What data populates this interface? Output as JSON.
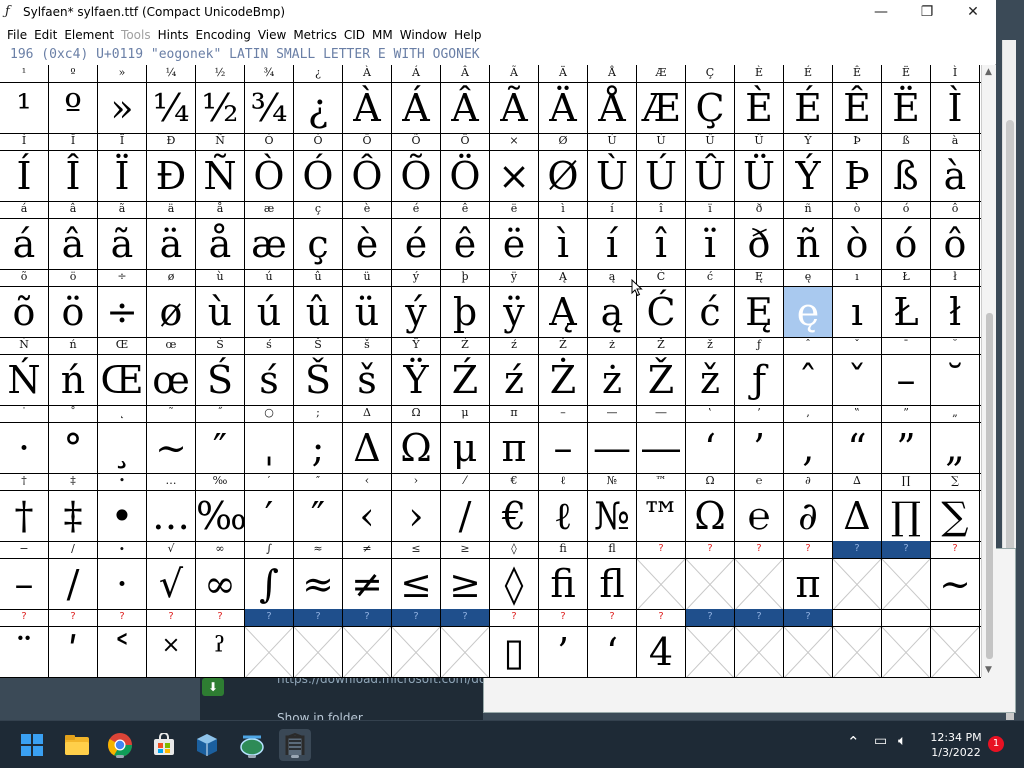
{
  "window": {
    "app_icon": "fontforge-f-icon",
    "title": "Sylfaen*  sylfaen.ttf (Compact UnicodeBmp)",
    "minimize": "—",
    "maximize": "❐",
    "close": "✕"
  },
  "menu": [
    "File",
    "Edit",
    "Element",
    "Tools",
    "Hints",
    "Encoding",
    "View",
    "Metrics",
    "CID",
    "MM",
    "Window",
    "Help"
  ],
  "menu_disabled": [
    "Tools"
  ],
  "info_line": "196 (0xc4) U+0119 \"eogonek\" LATIN SMALL LETTER E WITH OGONEK",
  "grid": {
    "rows": [
      {
        "labels": [
          "¹",
          "º",
          "»",
          "¼",
          "½",
          "¾",
          "¿",
          "À",
          "Á",
          "Â",
          "Ã",
          "Ä",
          "Å",
          "Æ",
          "Ç",
          "È",
          "É",
          "Ê",
          "Ë",
          "Ì"
        ],
        "glyphs": [
          "¹",
          "º",
          "»",
          "¼",
          "½",
          "¾",
          "¿",
          "À",
          "Á",
          "Â",
          "Ã",
          "Ä",
          "Å",
          "Æ",
          "Ç",
          "È",
          "É",
          "Ê",
          "Ë",
          "Ì"
        ]
      },
      {
        "labels": [
          "Í",
          "Î",
          "Ï",
          "Ð",
          "Ñ",
          "Ò",
          "Ó",
          "Ô",
          "Õ",
          "Ö",
          "×",
          "Ø",
          "Ù",
          "Ú",
          "Û",
          "Ü",
          "Ý",
          "Þ",
          "ß",
          "à"
        ],
        "glyphs": [
          "Í",
          "Î",
          "Ï",
          "Ð",
          "Ñ",
          "Ò",
          "Ó",
          "Ô",
          "Õ",
          "Ö",
          "×",
          "Ø",
          "Ù",
          "Ú",
          "Û",
          "Ü",
          "Ý",
          "Þ",
          "ß",
          "à"
        ]
      },
      {
        "labels": [
          "á",
          "â",
          "ã",
          "ä",
          "å",
          "æ",
          "ç",
          "è",
          "é",
          "ê",
          "ë",
          "ì",
          "í",
          "î",
          "ï",
          "ð",
          "ñ",
          "ò",
          "ó",
          "ô"
        ],
        "glyphs": [
          "á",
          "â",
          "ã",
          "ä",
          "å",
          "æ",
          "ç",
          "è",
          "é",
          "ê",
          "ë",
          "ì",
          "í",
          "î",
          "ï",
          "ð",
          "ñ",
          "ò",
          "ó",
          "ô"
        ]
      },
      {
        "labels": [
          "õ",
          "ö",
          "÷",
          "ø",
          "ù",
          "ú",
          "û",
          "ü",
          "ý",
          "þ",
          "ÿ",
          "Ą",
          "ą",
          "Ć",
          "ć",
          "Ę",
          "ę",
          "ı",
          "Ł",
          "ł"
        ],
        "glyphs": [
          "õ",
          "ö",
          "÷",
          "ø",
          "ù",
          "ú",
          "û",
          "ü",
          "ý",
          "þ",
          "ÿ",
          "Ą",
          "ą",
          "Ć",
          "ć",
          "Ę",
          "ę",
          "ı",
          "Ł",
          "ł"
        ]
      },
      {
        "labels": [
          "Ń",
          "ń",
          "Œ",
          "œ",
          "Ś",
          "ś",
          "Š",
          "š",
          "Ÿ",
          "Ź",
          "ź",
          "Ż",
          "ż",
          "Ž",
          "ž",
          "ƒ",
          "ˆ",
          "ˇ",
          "¯",
          "˘"
        ],
        "glyphs": [
          "Ń",
          "ń",
          "Œ",
          "œ",
          "Ś",
          "ś",
          "Š",
          "š",
          "Ÿ",
          "Ź",
          "ź",
          "Ż",
          "ż",
          "Ž",
          "ž",
          "ƒ",
          "ˆ",
          "ˇ",
          "–",
          "˘"
        ]
      },
      {
        "labels": [
          "˙",
          "˚",
          "˛",
          "˜",
          "˝",
          "○",
          ";",
          "Δ",
          "Ω",
          "μ",
          "π",
          "–",
          "—",
          "―",
          "‛",
          "’",
          "‚",
          "‟",
          "”",
          "„"
        ],
        "glyphs": [
          "·",
          "°",
          "¸",
          "~",
          "″",
          "ˌ",
          ";",
          "Δ",
          "Ω",
          "μ",
          "π",
          "–",
          "—",
          "―",
          "‘",
          "’",
          "‚",
          "“",
          "”",
          "„"
        ]
      },
      {
        "labels": [
          "†",
          "‡",
          "•",
          "…",
          "‰",
          "′",
          "″",
          "‹",
          "›",
          "⁄",
          "€",
          "ℓ",
          "№",
          "™",
          "Ω",
          "℮",
          "∂",
          "∆",
          "∏",
          "∑"
        ],
        "glyphs": [
          "†",
          "‡",
          "•",
          "…",
          "‰",
          "′",
          "″",
          "‹",
          "›",
          "/",
          "€",
          "ℓ",
          "№",
          "™",
          "Ω",
          "℮",
          "∂",
          "Δ",
          "∏",
          "∑"
        ]
      },
      {
        "labels": [
          "−",
          "∕",
          "∙",
          "√",
          "∞",
          "∫",
          "≈",
          "≠",
          "≤",
          "≥",
          "◊",
          "ﬁ",
          "ﬂ",
          "?",
          "?",
          "?",
          "?",
          "?",
          "?",
          "?"
        ],
        "glyphs": [
          "–",
          "/",
          "·",
          "√",
          "∞",
          "∫",
          "≈",
          "≠",
          "≤",
          "≥",
          "◊",
          "ﬁ",
          "ﬂ",
          "▯",
          "",
          "",
          "π",
          "",
          "",
          "~"
        ]
      },
      {
        "labels": [
          "?",
          "?",
          "?",
          "?",
          "?",
          "?",
          "?",
          "?",
          "?",
          "?",
          "?",
          "?",
          "?",
          "?",
          "?",
          "?",
          "?",
          "",
          "",
          ""
        ],
        "glyphs": [
          "¨",
          "ʹ",
          "˂",
          "˟",
          "ˀ",
          "",
          "",
          "",
          "",
          "",
          "▯",
          "’",
          "‘",
          "4",
          "",
          "",
          "",
          "",
          "",
          ""
        ]
      }
    ],
    "selected_glyph": "ę"
  },
  "background": {
    "download_url": "https://download.microsoft.com/do",
    "show_in_folder": "Show in folder"
  },
  "taskbar": {
    "apps": [
      "windows-start-icon",
      "file-explorer-icon",
      "chrome-icon",
      "microsoft-store-icon",
      "virtualbox-icon",
      "network-globe-icon",
      "fontforge-icon"
    ],
    "time": "12:34 PM",
    "date": "1/3/2022",
    "notifications": "1"
  },
  "colors": {
    "accent_blue": "#1f4f8c",
    "selected_cell": "#a9c9ef",
    "info_text": "#6a7fa6",
    "missing_glyph_label": "#d22222",
    "taskbar": "#1e2a36"
  }
}
